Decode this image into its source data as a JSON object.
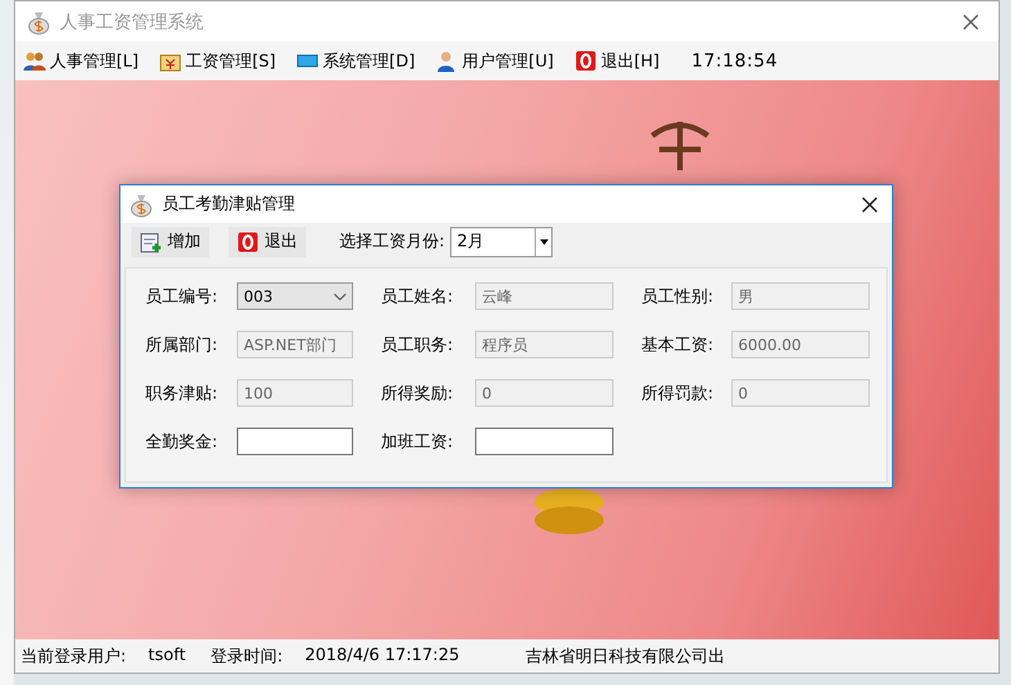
{
  "window": {
    "title": "人事工资管理系统"
  },
  "menu": [
    {
      "label": "人事管理[L]"
    },
    {
      "label": "工资管理[S]"
    },
    {
      "label": "系统管理[D]"
    },
    {
      "label": "用户管理[U]"
    },
    {
      "label": "退出[H]"
    }
  ],
  "clock": "17:18:54",
  "dialog": {
    "title": "员工考勤津贴管理",
    "toolbar": [
      {
        "label": "增加"
      },
      {
        "label": "退出"
      }
    ],
    "month_label": "选择工资月份:",
    "month_value": "2月",
    "fields": [
      {
        "label": "员工编号:",
        "value": "003",
        "kind": "dropdown"
      },
      {
        "label": "员工姓名:",
        "value": "云峰",
        "kind": "readonly"
      },
      {
        "label": "员工性别:",
        "value": "男",
        "kind": "readonly"
      },
      {
        "label": "所属部门:",
        "value": "ASP.NET部门",
        "kind": "readonly"
      },
      {
        "label": "员工职务:",
        "value": "程序员",
        "kind": "readonly"
      },
      {
        "label": "基本工资:",
        "value": "6000.00",
        "kind": "readonly"
      },
      {
        "label": "职务津贴:",
        "value": "100",
        "kind": "readonly"
      },
      {
        "label": "所得奖励:",
        "value": "0",
        "kind": "readonly"
      },
      {
        "label": "所得罚款:",
        "value": "0",
        "kind": "readonly"
      },
      {
        "label": "全勤奖金:",
        "kind": "input"
      },
      {
        "label": "加班工资:",
        "kind": "input"
      }
    ]
  },
  "status_bar": [
    {
      "label": "当前登录用户:",
      "value": "tsoft"
    },
    {
      "label": "登录时间:",
      "value": "2018/4/6 17:17:25"
    },
    {
      "label": "吉林省明日科技有限公司出"
    }
  ]
}
